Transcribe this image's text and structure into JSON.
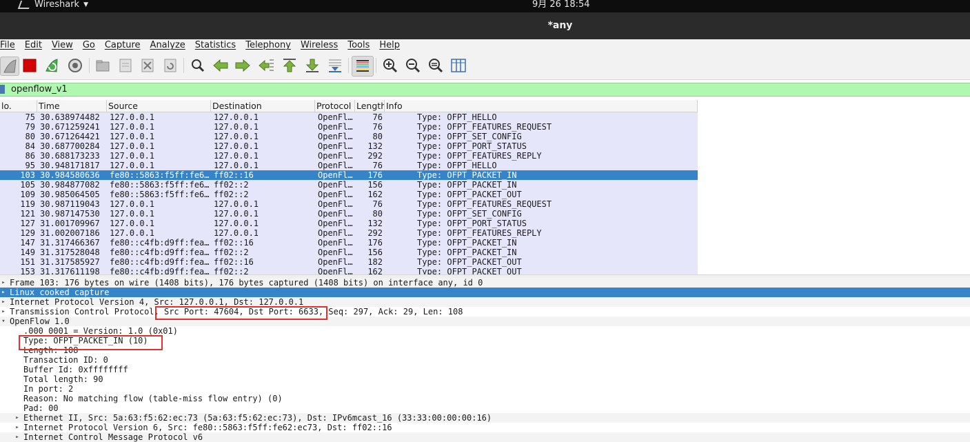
{
  "system": {
    "app_name": "Wireshark",
    "clock": "9月 26  18:54"
  },
  "window": {
    "title": "*any"
  },
  "menu": [
    "File",
    "Edit",
    "View",
    "Go",
    "Capture",
    "Analyze",
    "Statistics",
    "Telephony",
    "Wireless",
    "Tools",
    "Help"
  ],
  "toolbar": [
    "shark-fin-start-icon",
    "stop-capture-icon",
    "restart-capture-icon",
    "capture-options-icon",
    "open-file-icon",
    "save-file-icon",
    "close-file-icon",
    "reload-file-icon",
    "find-packet-icon",
    "go-back-icon",
    "go-forward-icon",
    "go-to-packet-icon",
    "go-first-icon",
    "go-last-icon",
    "autoscroll-icon",
    "colorize-icon",
    "zoom-in-icon",
    "zoom-out-icon",
    "zoom-normal-icon",
    "resize-columns-icon"
  ],
  "filter": {
    "value": "openflow_v1"
  },
  "columns": [
    "lo.",
    "Time",
    "Source",
    "Destination",
    "Protocol",
    "Length",
    "Info"
  ],
  "packets": [
    {
      "no": "75",
      "time": "30.638974482",
      "src": "127.0.0.1",
      "dst": "127.0.0.1",
      "proto": "OpenFl…",
      "len": "76",
      "info": "Type: OFPT_HELLO"
    },
    {
      "no": "79",
      "time": "30.671259241",
      "src": "127.0.0.1",
      "dst": "127.0.0.1",
      "proto": "OpenFl…",
      "len": "76",
      "info": "Type: OFPT_FEATURES_REQUEST"
    },
    {
      "no": "80",
      "time": "30.671264421",
      "src": "127.0.0.1",
      "dst": "127.0.0.1",
      "proto": "OpenFl…",
      "len": "80",
      "info": "Type: OFPT_SET_CONFIG"
    },
    {
      "no": "84",
      "time": "30.687700284",
      "src": "127.0.0.1",
      "dst": "127.0.0.1",
      "proto": "OpenFl…",
      "len": "132",
      "info": "Type: OFPT_PORT_STATUS"
    },
    {
      "no": "86",
      "time": "30.688173233",
      "src": "127.0.0.1",
      "dst": "127.0.0.1",
      "proto": "OpenFl…",
      "len": "292",
      "info": "Type: OFPT_FEATURES_REPLY"
    },
    {
      "no": "95",
      "time": "30.948171817",
      "src": "127.0.0.1",
      "dst": "127.0.0.1",
      "proto": "OpenFl…",
      "len": "76",
      "info": "Type: OFPT_HELLO"
    },
    {
      "no": "103",
      "time": "30.984580636",
      "src": "fe80::5863:f5ff:fe6…",
      "dst": "ff02::16",
      "proto": "OpenFl…",
      "len": "176",
      "info": "Type: OFPT_PACKET_IN",
      "selected": true
    },
    {
      "no": "105",
      "time": "30.984877082",
      "src": "fe80::5863:f5ff:fe6…",
      "dst": "ff02::2",
      "proto": "OpenFl…",
      "len": "156",
      "info": "Type: OFPT_PACKET_IN"
    },
    {
      "no": "109",
      "time": "30.985064505",
      "src": "fe80::5863:f5ff:fe6…",
      "dst": "ff02::2",
      "proto": "OpenFl…",
      "len": "162",
      "info": "Type: OFPT_PACKET_OUT"
    },
    {
      "no": "119",
      "time": "30.987119043",
      "src": "127.0.0.1",
      "dst": "127.0.0.1",
      "proto": "OpenFl…",
      "len": "76",
      "info": "Type: OFPT_FEATURES_REQUEST"
    },
    {
      "no": "121",
      "time": "30.987147530",
      "src": "127.0.0.1",
      "dst": "127.0.0.1",
      "proto": "OpenFl…",
      "len": "80",
      "info": "Type: OFPT_SET_CONFIG"
    },
    {
      "no": "127",
      "time": "31.001709967",
      "src": "127.0.0.1",
      "dst": "127.0.0.1",
      "proto": "OpenFl…",
      "len": "132",
      "info": "Type: OFPT_PORT_STATUS"
    },
    {
      "no": "129",
      "time": "31.002007186",
      "src": "127.0.0.1",
      "dst": "127.0.0.1",
      "proto": "OpenFl…",
      "len": "292",
      "info": "Type: OFPT_FEATURES_REPLY"
    },
    {
      "no": "147",
      "time": "31.317466367",
      "src": "fe80::c4fb:d9ff:fea…",
      "dst": "ff02::16",
      "proto": "OpenFl…",
      "len": "176",
      "info": "Type: OFPT_PACKET_IN"
    },
    {
      "no": "149",
      "time": "31.317528048",
      "src": "fe80::c4fb:d9ff:fea…",
      "dst": "ff02::2",
      "proto": "OpenFl…",
      "len": "156",
      "info": "Type: OFPT_PACKET_IN"
    },
    {
      "no": "151",
      "time": "31.317585927",
      "src": "fe80::c4fb:d9ff:fea…",
      "dst": "ff02::16",
      "proto": "OpenFl…",
      "len": "182",
      "info": "Type: OFPT_PACKET_OUT"
    },
    {
      "no": "153",
      "time": "31.317611198",
      "src": "fe80::c4fb:d9ff:fea…",
      "dst": "ff02::2",
      "proto": "OpenFl…",
      "len": "162",
      "info": "Type: OFPT_PACKET_OUT"
    }
  ],
  "details": [
    {
      "indent": 0,
      "arrow": "right",
      "text": "Frame 103: 176 bytes on wire (1408 bits), 176 bytes captured (1408 bits) on interface any, id 0",
      "shade": true
    },
    {
      "indent": 0,
      "arrow": "right",
      "text": "Linux cooked capture",
      "selected": true
    },
    {
      "indent": 0,
      "arrow": "right",
      "text": "Internet Protocol Version 4, Src: 127.0.0.1, Dst: 127.0.0.1",
      "shade": true
    },
    {
      "indent": 0,
      "arrow": "right",
      "text": "Transmission Control Protocol, Src Port: 47604, Dst Port: 6633, Seq: 297, Ack: 29, Len: 108"
    },
    {
      "indent": 0,
      "arrow": "down",
      "text": "OpenFlow 1.0",
      "shade": true
    },
    {
      "indent": 1,
      "arrow": "",
      "text": ".000 0001 = Version: 1.0 (0x01)"
    },
    {
      "indent": 1,
      "arrow": "",
      "text": "Type: OFPT_PACKET_IN (10)"
    },
    {
      "indent": 1,
      "arrow": "",
      "text": "Length: 108"
    },
    {
      "indent": 1,
      "arrow": "",
      "text": "Transaction ID: 0"
    },
    {
      "indent": 1,
      "arrow": "",
      "text": "Buffer Id: 0xffffffff"
    },
    {
      "indent": 1,
      "arrow": "",
      "text": "Total length: 90"
    },
    {
      "indent": 1,
      "arrow": "",
      "text": "In port: 2"
    },
    {
      "indent": 1,
      "arrow": "",
      "text": "Reason: No matching flow (table-miss flow entry) (0)"
    },
    {
      "indent": 1,
      "arrow": "",
      "text": "Pad: 00"
    },
    {
      "indent": 1,
      "arrow": "right",
      "text": "Ethernet II, Src: 5a:63:f5:62:ec:73 (5a:63:f5:62:ec:73), Dst: IPv6mcast_16 (33:33:00:00:00:16)",
      "shade": true
    },
    {
      "indent": 1,
      "arrow": "right",
      "text": "Internet Protocol Version 6, Src: fe80::5863:f5ff:fe62:ec73, Dst: ff02::16"
    },
    {
      "indent": 1,
      "arrow": "right",
      "text": "Internet Control Message Protocol v6",
      "shade": true
    }
  ],
  "colors": {
    "selected": "#3584c9",
    "row_bg": "#e6e6fa",
    "filter_ok": "#b0f7b0",
    "highlight_box": "#e03030"
  }
}
